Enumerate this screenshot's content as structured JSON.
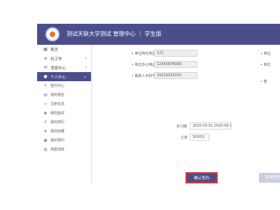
{
  "header": {
    "title": "测试天联大学测试 管理中心 ｜ 学生版"
  },
  "sidebar": {
    "items": [
      {
        "label": "首页",
        "icon": "home-icon",
        "has_chevron": false
      },
      {
        "label": "抗工作",
        "icon": "briefcase-icon",
        "has_chevron": true
      },
      {
        "label": "消息中心",
        "icon": "message-icon",
        "has_chevron": true
      },
      {
        "label": "个人中心",
        "icon": "user-icon",
        "has_chevron": true,
        "active": true
      }
    ],
    "subitems": [
      {
        "label": "签约中心",
        "icon": "contract-icon"
      },
      {
        "label": "我的报告",
        "icon": "report-icon"
      },
      {
        "label": "注册信息",
        "icon": "id-card-icon"
      },
      {
        "label": "我的面试",
        "icon": "interview-icon"
      },
      {
        "label": "我的简历",
        "icon": "resume-icon"
      },
      {
        "label": "我的收藏",
        "icon": "favorite-icon"
      },
      {
        "label": "我的预约",
        "icon": "calendar-icon"
      },
      {
        "label": "档案流转",
        "icon": "archive-icon"
      }
    ]
  },
  "form": {
    "fields": [
      {
        "label": "单位所在地区",
        "value": "121"
      },
      {
        "label": "单位办公电话",
        "value": "12345678909"
      },
      {
        "label": "联系人手机号",
        "value": "19133333333"
      }
    ],
    "period_label": "实习期",
    "period_value": "2020-03-01 2020-06-01",
    "salary_label": "工资",
    "salary_value": "3000元"
  },
  "right_labels": [
    "单位",
    "单位",
    "意"
  ],
  "buttons": {
    "confirm": "确认签约",
    "cancel": "拒绝签约"
  },
  "colors": {
    "primary": "#4a4f8c",
    "highlight_border": "#d9343a"
  }
}
